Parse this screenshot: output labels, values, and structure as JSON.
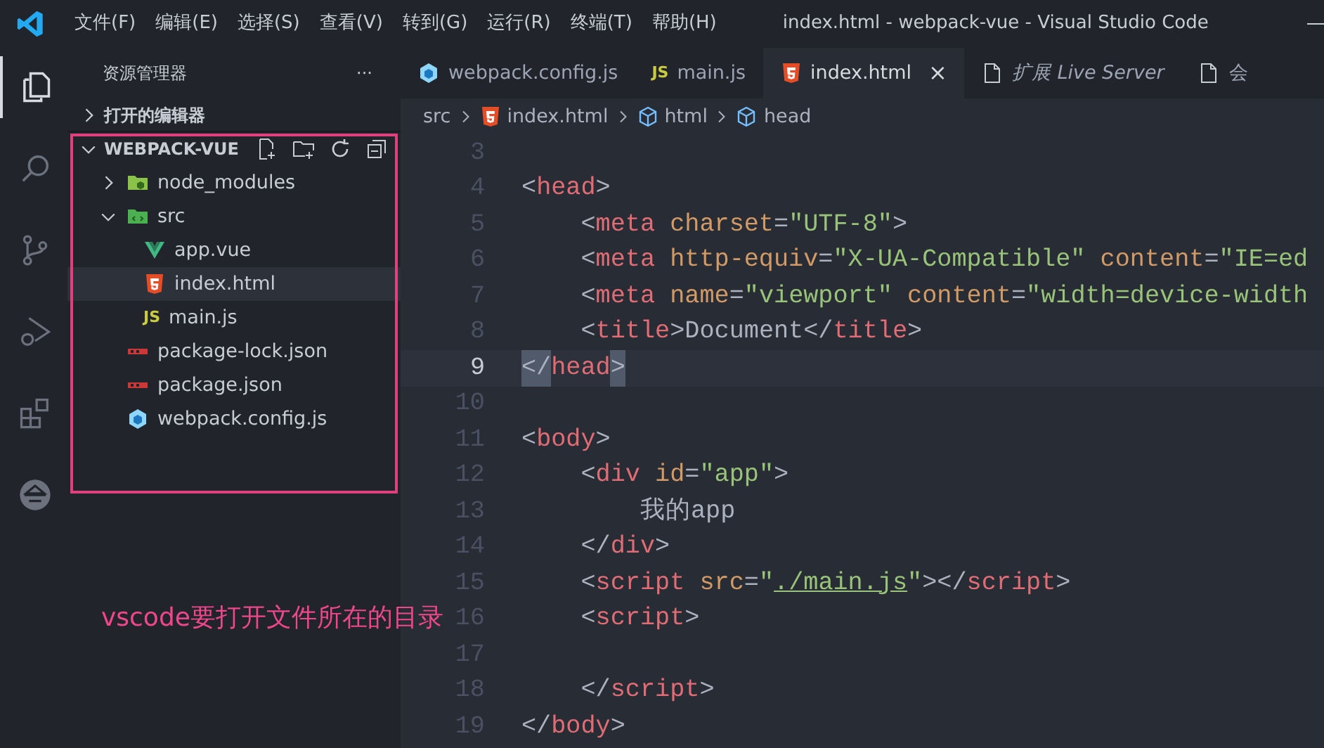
{
  "title_bar": {
    "menu": [
      "文件(F)",
      "编辑(E)",
      "选择(S)",
      "查看(V)",
      "转到(G)",
      "运行(R)",
      "终端(T)",
      "帮助(H)"
    ],
    "title": "index.html - webpack-vue - Visual Studio Code"
  },
  "activity_bar": [
    {
      "kind": "files",
      "selected": true
    },
    {
      "kind": "search",
      "selected": false
    },
    {
      "kind": "branch",
      "selected": false
    },
    {
      "kind": "debug",
      "selected": false
    },
    {
      "kind": "blocks",
      "selected": false
    },
    {
      "kind": "round",
      "selected": false
    }
  ],
  "sidebar": {
    "title": "资源管理器",
    "more": "···",
    "open_editors": {
      "label": "打开的编辑器",
      "expanded": false
    },
    "folder": {
      "label": "WEBPACK-VUE",
      "expanded": true,
      "items": [
        {
          "name": "node_modules",
          "kind": "folder-node",
          "expanded": false,
          "selected": false
        },
        {
          "name": "src",
          "kind": "folder-src",
          "expanded": true,
          "selected": false,
          "children": [
            {
              "name": "app.vue",
              "kind": "vue",
              "selected": false
            },
            {
              "name": "index.html",
              "kind": "html",
              "selected": true
            },
            {
              "name": "main.js",
              "kind": "js",
              "icon_text": "JS",
              "selected": false
            }
          ]
        },
        {
          "name": "package-lock.json",
          "kind": "npm",
          "selected": false
        },
        {
          "name": "package.json",
          "kind": "npm",
          "selected": false
        },
        {
          "name": "webpack.config.js",
          "kind": "webpack",
          "selected": false
        }
      ]
    }
  },
  "tabs": [
    {
      "label": "webpack.config.js",
      "kind": "webpack",
      "selected": false,
      "preview": false
    },
    {
      "label": "main.js",
      "kind": "js",
      "icon_text": "JS",
      "selected": false,
      "preview": false
    },
    {
      "label": "index.html",
      "kind": "html",
      "selected": true,
      "preview": false,
      "close": "×"
    },
    {
      "label": "扩展 Live Server",
      "kind": "page",
      "selected": false,
      "preview": true
    },
    {
      "label": "会",
      "kind": "page",
      "selected": false,
      "preview": false
    }
  ],
  "breadcrumb": [
    {
      "label": "src",
      "kind": "none"
    },
    {
      "label": "index.html",
      "kind": "html"
    },
    {
      "label": "html",
      "kind": "cube"
    },
    {
      "label": "head",
      "kind": "cube"
    }
  ],
  "editor": {
    "lines": [
      {
        "number": "3",
        "current": false
      },
      {
        "number": "4",
        "current": false,
        "tokens": [
          {
            "t": "<",
            "kind": "p"
          },
          {
            "t": "head",
            "kind": "tag"
          },
          {
            "t": ">",
            "kind": "p"
          }
        ]
      },
      {
        "number": "5",
        "current": false,
        "tokens": [
          {
            "t": "    <",
            "kind": "p"
          },
          {
            "t": "meta",
            "kind": "tag"
          },
          {
            "t": " charset",
            "kind": "attr"
          },
          {
            "t": "=",
            "kind": "p"
          },
          {
            "t": "\"UTF-8\"",
            "kind": "str"
          },
          {
            "t": ">",
            "kind": "p"
          }
        ]
      },
      {
        "number": "6",
        "current": false,
        "tokens": [
          {
            "t": "    <",
            "kind": "p"
          },
          {
            "t": "meta",
            "kind": "tag"
          },
          {
            "t": " http-equiv",
            "kind": "attr"
          },
          {
            "t": "=",
            "kind": "p"
          },
          {
            "t": "\"X-UA-Compatible\"",
            "kind": "str"
          },
          {
            "t": " content",
            "kind": "attr"
          },
          {
            "t": "=",
            "kind": "p"
          },
          {
            "t": "\"IE=ed",
            "kind": "str"
          }
        ]
      },
      {
        "number": "7",
        "current": false,
        "tokens": [
          {
            "t": "    <",
            "kind": "p"
          },
          {
            "t": "meta",
            "kind": "tag"
          },
          {
            "t": " name",
            "kind": "attr"
          },
          {
            "t": "=",
            "kind": "p"
          },
          {
            "t": "\"viewport\"",
            "kind": "str"
          },
          {
            "t": " content",
            "kind": "attr"
          },
          {
            "t": "=",
            "kind": "p"
          },
          {
            "t": "\"width=device-width",
            "kind": "str"
          }
        ]
      },
      {
        "number": "8",
        "current": false,
        "tokens": [
          {
            "t": "    <",
            "kind": "p"
          },
          {
            "t": "title",
            "kind": "tag"
          },
          {
            "t": ">Document</",
            "kind": "p"
          },
          {
            "t": "title",
            "kind": "tag"
          },
          {
            "t": ">",
            "kind": "p"
          }
        ]
      },
      {
        "number": "9",
        "current": true,
        "tokens": [
          {
            "t": "</",
            "kind": "match"
          },
          {
            "t": "head",
            "kind": "tag"
          },
          {
            "t": ">",
            "kind": "match"
          }
        ]
      },
      {
        "number": "10",
        "current": false
      },
      {
        "number": "11",
        "current": false,
        "tokens": [
          {
            "t": "<",
            "kind": "p"
          },
          {
            "t": "body",
            "kind": "tag"
          },
          {
            "t": ">",
            "kind": "p"
          }
        ]
      },
      {
        "number": "12",
        "current": false,
        "tokens": [
          {
            "t": "    <",
            "kind": "p"
          },
          {
            "t": "div",
            "kind": "tag"
          },
          {
            "t": " id",
            "kind": "attr"
          },
          {
            "t": "=",
            "kind": "p"
          },
          {
            "t": "\"app\"",
            "kind": "str"
          },
          {
            "t": ">",
            "kind": "p"
          }
        ]
      },
      {
        "number": "13",
        "current": false,
        "tokens": [
          {
            "t": "        我的app",
            "kind": "p"
          }
        ]
      },
      {
        "number": "14",
        "current": false,
        "tokens": [
          {
            "t": "    </",
            "kind": "p"
          },
          {
            "t": "div",
            "kind": "tag"
          },
          {
            "t": ">",
            "kind": "p"
          }
        ]
      },
      {
        "number": "15",
        "current": false,
        "tokens": [
          {
            "t": "    <",
            "kind": "p"
          },
          {
            "t": "script",
            "kind": "tag"
          },
          {
            "t": " src",
            "kind": "attr"
          },
          {
            "t": "=",
            "kind": "p"
          },
          {
            "t": "\"",
            "kind": "str"
          },
          {
            "t": "./main.js",
            "kind": "link"
          },
          {
            "t": "\"",
            "kind": "str"
          },
          {
            "t": "></",
            "kind": "p"
          },
          {
            "t": "script",
            "kind": "tag"
          },
          {
            "t": ">",
            "kind": "p"
          }
        ]
      },
      {
        "number": "16",
        "current": false,
        "tokens": [
          {
            "t": "    <",
            "kind": "p"
          },
          {
            "t": "script",
            "kind": "tag"
          },
          {
            "t": ">",
            "kind": "p"
          }
        ]
      },
      {
        "number": "17",
        "current": false
      },
      {
        "number": "18",
        "current": false,
        "tokens": [
          {
            "t": "    </",
            "kind": "p"
          },
          {
            "t": "script",
            "kind": "tag"
          },
          {
            "t": ">",
            "kind": "p"
          }
        ]
      },
      {
        "number": "19",
        "current": false,
        "tokens": [
          {
            "t": "</",
            "kind": "p"
          },
          {
            "t": "body",
            "kind": "tag"
          },
          {
            "t": ">",
            "kind": "p"
          }
        ]
      }
    ]
  },
  "annotation": {
    "text": "vscode要打开文件所在的目录"
  }
}
